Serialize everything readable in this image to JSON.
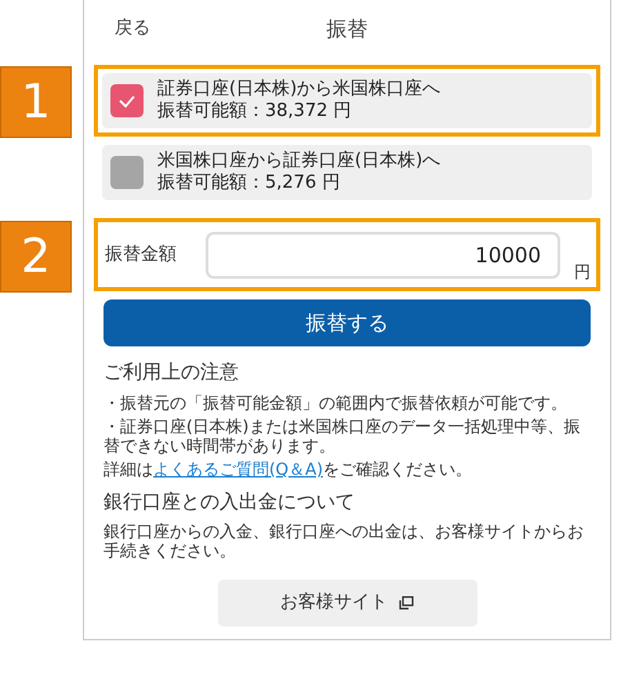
{
  "annotations": [
    {
      "number": "1"
    },
    {
      "number": "2"
    }
  ],
  "header": {
    "back": "戻る",
    "title": "振替"
  },
  "options": [
    {
      "direction": "証券口座(日本株)から米国株口座へ",
      "available": "振替可能額：38,372 円",
      "selected": true
    },
    {
      "direction": "米国株口座から証券口座(日本株)へ",
      "available": "振替可能額：5,276 円",
      "selected": false
    }
  ],
  "amount": {
    "label": "振替金額",
    "value": "10000",
    "unit": "円"
  },
  "submit_button": "振替する",
  "notes": {
    "title": "ご利用上の注意",
    "items": [
      "・振替元の「振替可能金額」の範囲内で振替依頼が可能です。",
      "・証券口座(日本株)または米国株口座のデータ一括処理中等、振替できない時間帯があります。"
    ],
    "detail": {
      "before": "詳細は",
      "link": "よくあるご質問(Q＆A)",
      "after": "をご確認ください。"
    }
  },
  "bank": {
    "title": "銀行口座との入出金について",
    "text": "銀行口座からの入金、銀行口座への出金は、お客様サイトからお手続きください。",
    "button": "お客様サイト"
  }
}
